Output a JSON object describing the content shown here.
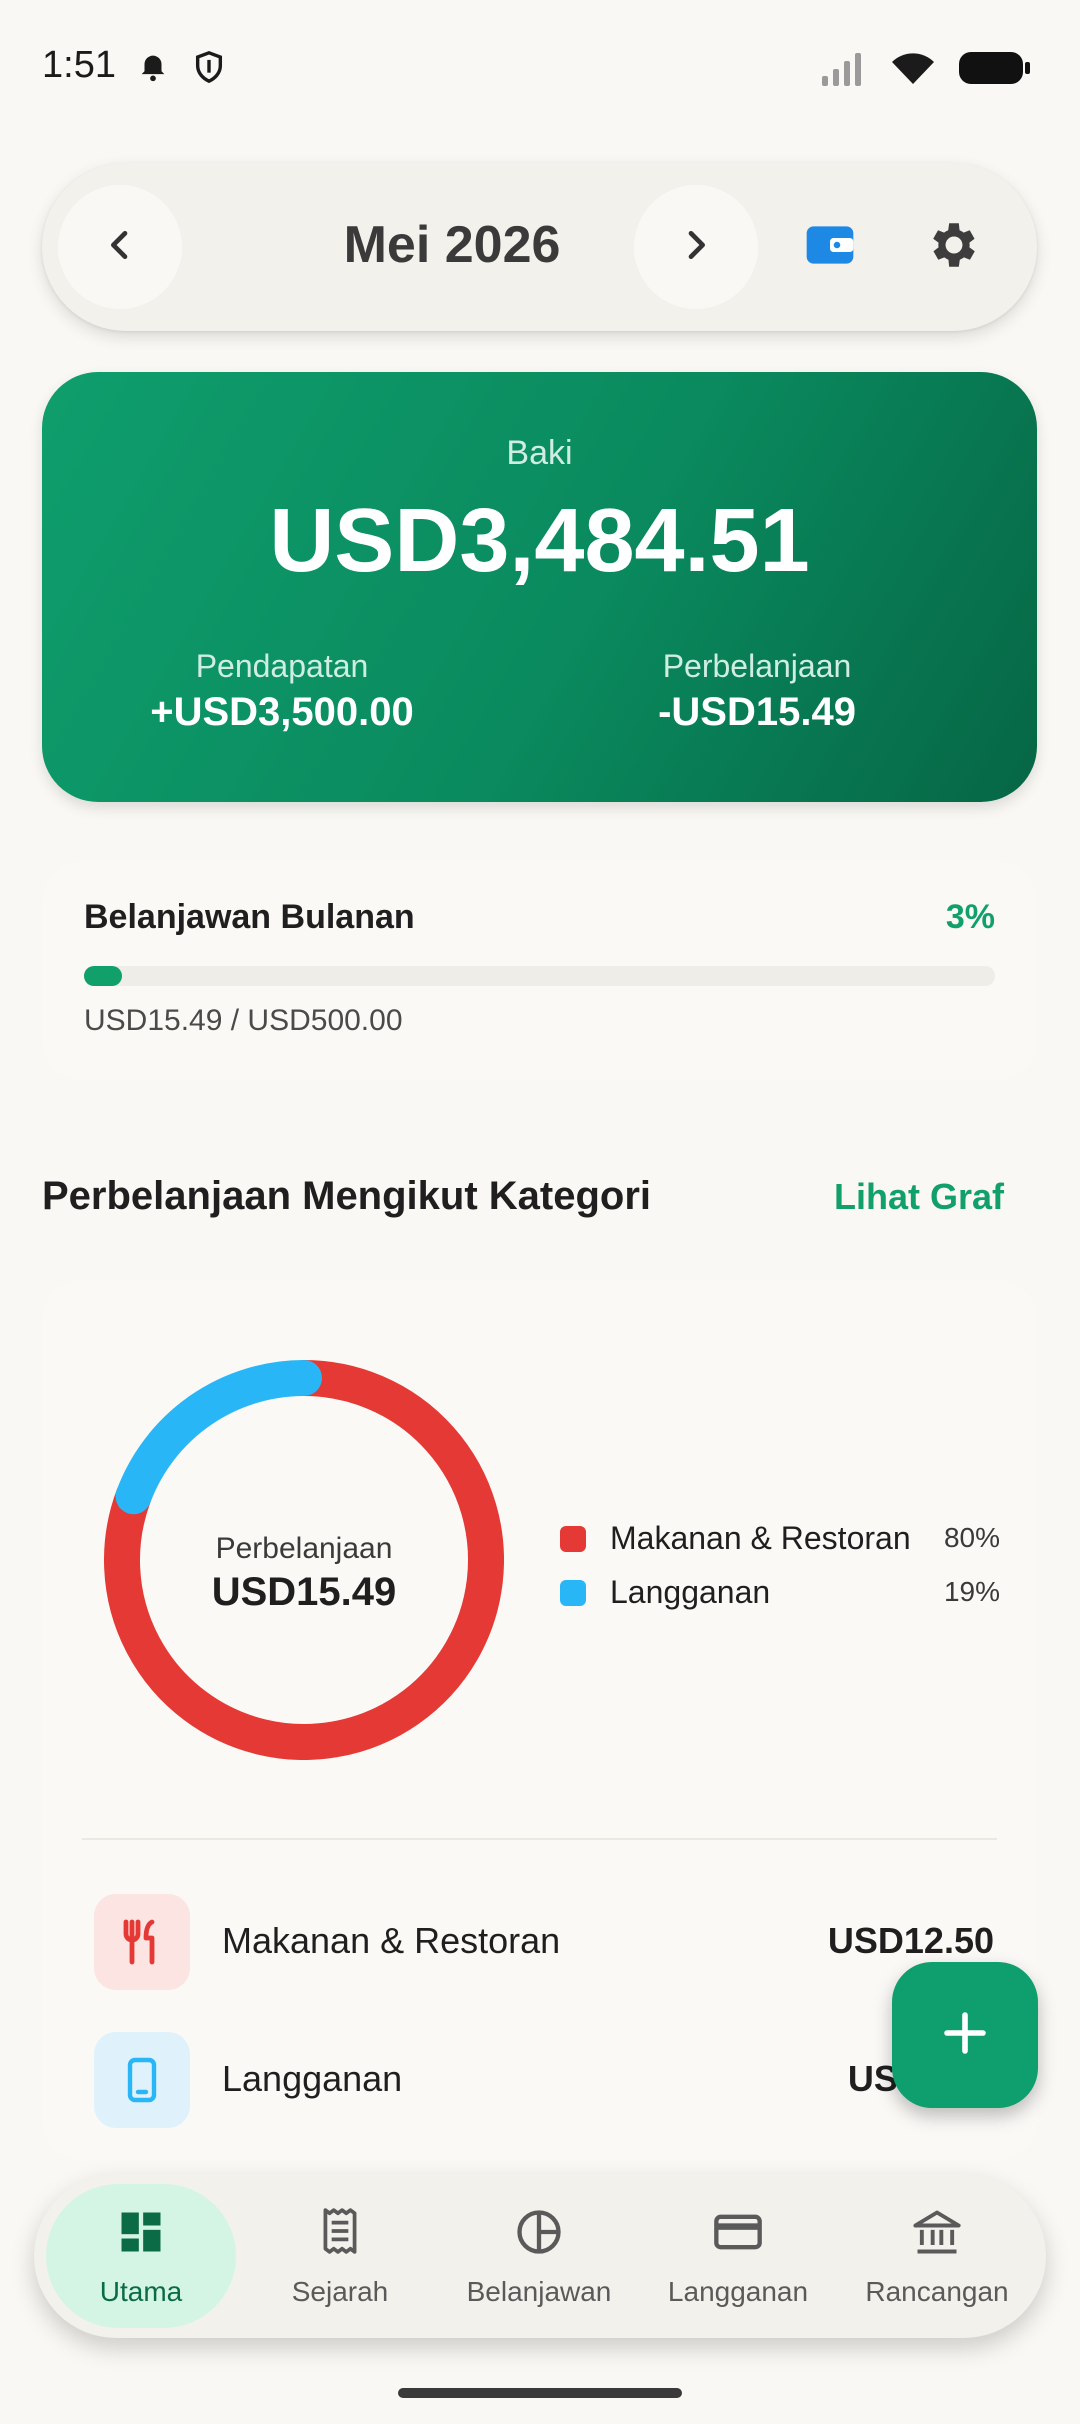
{
  "status_bar": {
    "time": "1:51",
    "icons_left": [
      "notification-icon",
      "shield-icon"
    ],
    "icons_right": [
      "signal-icon",
      "wifi-icon",
      "battery-icon"
    ]
  },
  "header": {
    "month": "Mei 2026",
    "prev_icon": "chevron-left-icon",
    "next_icon": "chevron-right-icon",
    "wallet_icon": "wallet-icon",
    "settings_icon": "gear-icon"
  },
  "balance": {
    "label": "Baki",
    "amount": "USD3,484.51",
    "income_label": "Pendapatan",
    "income_value": "+USD3,500.00",
    "expense_label": "Perbelanjaan",
    "expense_value": "-USD15.49"
  },
  "budget": {
    "title": "Belanjawan Bulanan",
    "percent_label": "3%",
    "progress": 0.03,
    "summary": "USD15.49 / USD500.00"
  },
  "category_section": {
    "title": "Perbelanjaan Mengikut Kategori",
    "link": "Lihat Graf"
  },
  "chart_data": {
    "type": "pie",
    "center_label": "Perbelanjaan",
    "center_value": "USD15.49",
    "slices": [
      {
        "name": "Makanan & Restoran",
        "percent_label": "80%",
        "value": 12.5,
        "color": "#e53935"
      },
      {
        "name": "Langganan",
        "percent_label": "19%",
        "value": 2.99,
        "color": "#29b6f6"
      }
    ]
  },
  "categories": [
    {
      "name": "Makanan & Restoran",
      "amount": "USD12.50",
      "icon": "restaurant-icon",
      "icon_bg": "#fbe4e1",
      "icon_color": "#e53935"
    },
    {
      "name": "Langganan",
      "amount": "USD2.99",
      "icon": "phone-icon",
      "icon_bg": "#dff1fb",
      "icon_color": "#29b6f6"
    }
  ],
  "fab": {
    "icon": "plus-icon"
  },
  "bottom_nav": [
    {
      "label": "Utama",
      "icon": "dashboard-icon",
      "active": true
    },
    {
      "label": "Sejarah",
      "icon": "receipt-icon",
      "active": false
    },
    {
      "label": "Belanjawan",
      "icon": "pie-chart-icon",
      "active": false
    },
    {
      "label": "Langganan",
      "icon": "credit-card-icon",
      "active": false
    },
    {
      "label": "Rancangan",
      "icon": "bank-icon",
      "active": false
    }
  ],
  "colors": {
    "accent": "#12a06a",
    "balance_card": "#0a8a5e",
    "background": "#faf8f4"
  }
}
